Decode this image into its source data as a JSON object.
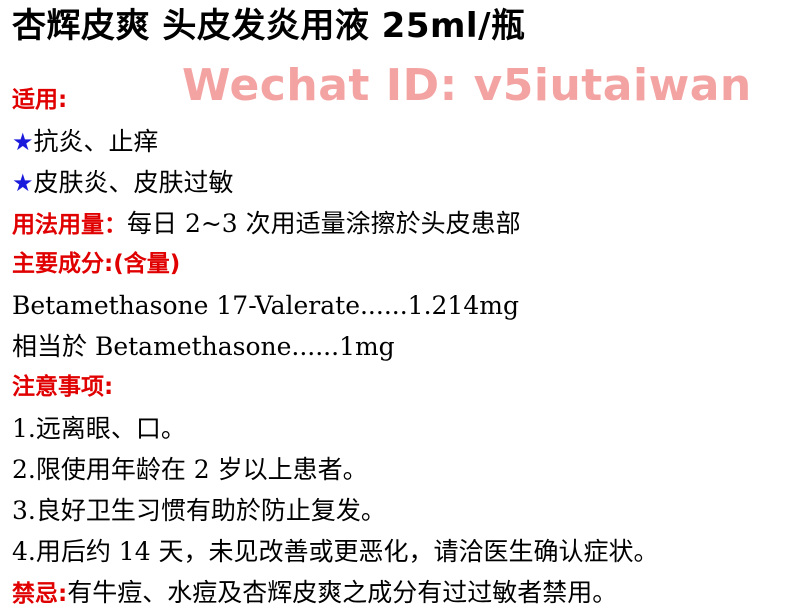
{
  "title": "杏辉皮爽 头皮发炎用液 25ml/瓶",
  "watermark": "Wechat ID: v5iutaiwan",
  "colors": {
    "heading": "#e00000",
    "star": "#1a1adc",
    "watermark": "#f4a3a3",
    "text": "#000000"
  },
  "usage": {
    "heading": "适用:",
    "items": [
      {
        "star": "★",
        "text": "抗炎、止痒"
      },
      {
        "star": "★",
        "text": "皮肤炎、皮肤过敏"
      }
    ]
  },
  "dosage": {
    "label": "用法用量：",
    "text": "每日 2~3 次用适量涂擦於头皮患部"
  },
  "ingredients": {
    "heading": "主要成分:(含量)",
    "items": [
      "Betamethasone 17-Valerate......1.214mg",
      "相当於 Betamethasone......1mg"
    ]
  },
  "precautions": {
    "heading": "注意事项:",
    "items": [
      "1.远离眼、口。",
      "2.限使用年龄在 2 岁以上患者。",
      "3.良好卫生习惯有助於防止复发。",
      "4.用后约 14 天，未见改善或更恶化，请洽医生确认症状。"
    ]
  },
  "contraindications": {
    "label": "禁忌:",
    "text": "有牛痘、水痘及杏辉皮爽之成分有过过敏者禁用。"
  }
}
